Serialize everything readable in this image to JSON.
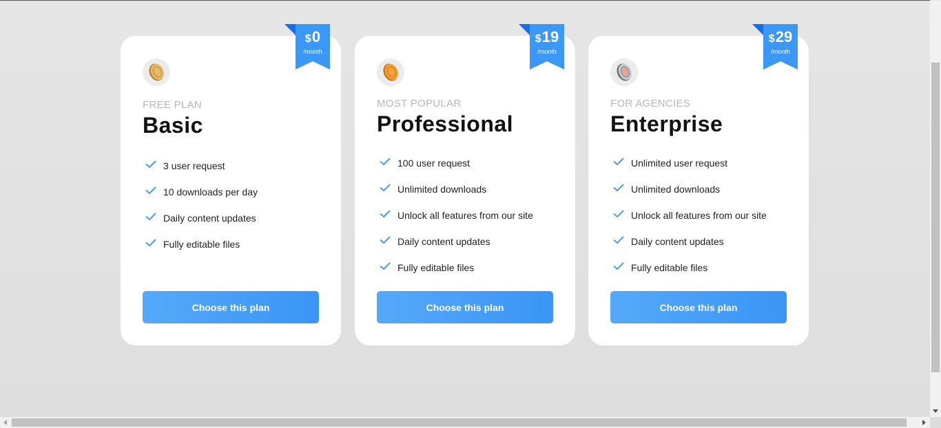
{
  "plans": [
    {
      "price_currency": "$",
      "price_amount": "0",
      "price_period": "/month",
      "icon": "gold-coin-icon",
      "eyebrow": "FREE PLAN",
      "title": "Basic",
      "features": [
        "3 user request",
        "10 downloads per day",
        "Daily content updates",
        "Fully editable files"
      ],
      "cta": "Choose this plan"
    },
    {
      "price_currency": "$",
      "price_amount": "19",
      "price_period": "/month",
      "icon": "orange-coin-icon",
      "eyebrow": "MOST POPULAR",
      "title": "Professional",
      "features": [
        "100 user request",
        "Unlimited downloads",
        "Unlock all features from our site",
        "Daily content updates",
        "Fully editable files"
      ],
      "cta": "Choose this plan"
    },
    {
      "price_currency": "$",
      "price_amount": "29",
      "price_period": "/month",
      "icon": "silver-coin-icon",
      "eyebrow": "FOR AGENCIES",
      "title": "Enterprise",
      "features": [
        "Unlimited user request",
        "Unlimited downloads",
        "Unlock all features from our site",
        "Daily content updates",
        "Fully editable files"
      ],
      "cta": "Choose this plan"
    }
  ],
  "colors": {
    "accent": "#3b98f7",
    "check": "#4a9cf0",
    "title": "#111111",
    "eyebrow": "#b8b8b8",
    "card": "#ffffff",
    "background": "#e3e3e3"
  }
}
